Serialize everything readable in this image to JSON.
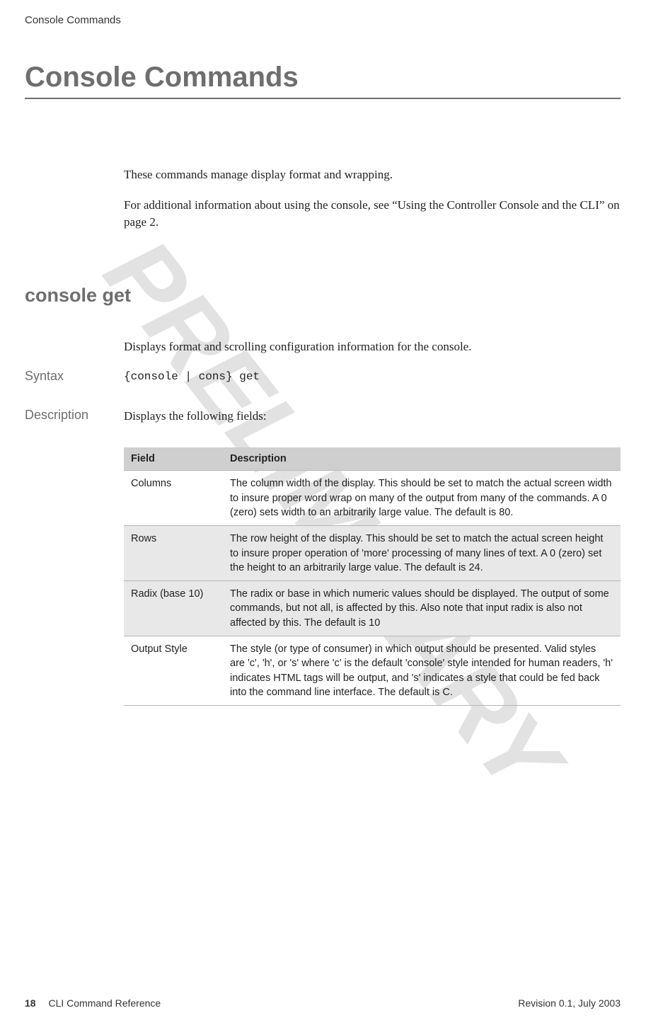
{
  "watermark": "PRELIMINARY",
  "header": {
    "running": "Console Commands"
  },
  "title": "Console Commands",
  "intro": {
    "p1": "These commands manage display format and wrapping.",
    "p2": "For additional information about using the console, see “Using the Controller Console and the CLI” on page 2."
  },
  "section": {
    "title": "console get",
    "summary": "Displays format and scrolling configuration information for the console.",
    "syntax_label": "Syntax",
    "syntax_code": "{console | cons} get",
    "description_label": "Description",
    "description_text": "Displays the following fields:"
  },
  "table": {
    "head_field": "Field",
    "head_desc": "Description",
    "rows": [
      {
        "field": "Columns",
        "desc": " The column width of the display. This should be set to match the actual screen width to insure proper word wrap on many of the output from many of the commands. A 0 (zero) sets width to an arbitrarily large value. The default is 80."
      },
      {
        "field": "Rows",
        "desc": " The row height of the display. This should be set to match the actual screen height to insure proper operation of 'more' processing of many lines of text. A 0 (zero) set the height to an arbitrarily large value. The default is 24."
      },
      {
        "field": "Radix (base 10)",
        "desc": " The radix or base in which numeric values should be displayed. The output of some commands, but not all, is affected by this. Also note that input radix is also not affected by this. The default is 10"
      },
      {
        "field": "Output Style",
        "desc": " The style (or type of consumer) in which output should be presented. Valid styles are 'c', 'h', or 's' where 'c' is the default 'console' style intended for human readers, 'h' indicates HTML tags will be output, and 's' indicates a style that could be fed back into the command line interface. The default is C."
      }
    ]
  },
  "footer": {
    "pagenum": "18",
    "doc": "CLI Command Reference",
    "revision": "Revision 0.1, July 2003"
  }
}
